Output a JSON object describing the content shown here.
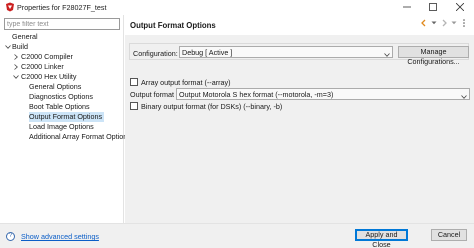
{
  "window": {
    "title": "Properties for F28027F_test"
  },
  "filter": {
    "placeholder": "type filter text"
  },
  "tree": {
    "items": [
      {
        "label": "General"
      },
      {
        "label": "Build"
      },
      {
        "label": "C2000 Compiler"
      },
      {
        "label": "C2000 Linker"
      },
      {
        "label": "C2000 Hex Utility"
      },
      {
        "label": "General Options"
      },
      {
        "label": "Diagnostics Options"
      },
      {
        "label": "Boot Table Options"
      },
      {
        "label": "Output Format Options"
      },
      {
        "label": "Load Image Options"
      },
      {
        "label": "Additional Array Format Option"
      }
    ],
    "selected_index": 8
  },
  "page": {
    "title": "Output Format Options"
  },
  "config": {
    "label": "Configuration:",
    "value": "Debug  [ Active ]",
    "manage_button": "Manage Configurations..."
  },
  "options": {
    "array_output_label": "Array output format (--array)",
    "array_output_checked": false,
    "output_format_label": "Output format",
    "output_format_value": "Output Motorola S hex format (--motorola, -m=3)",
    "binary_output_label": "Binary output format (for DSKs) (--binary, -b)",
    "binary_output_checked": false
  },
  "footer": {
    "advanced_link": "Show advanced settings",
    "apply_close_button": "Apply and Close",
    "cancel_button": "Cancel"
  },
  "colors": {
    "selection": "#cce4f7",
    "link": "#0b5ec7",
    "nav_orange": "#e08a1e",
    "app_icon_red": "#cc2020",
    "primary_border": "#0078d7"
  },
  "icons": {
    "app": "ccs-app-icon",
    "back": "back-arrow-icon",
    "forward": "forward-arrow-icon",
    "menu": "view-menu-icon",
    "help": "help-icon"
  }
}
